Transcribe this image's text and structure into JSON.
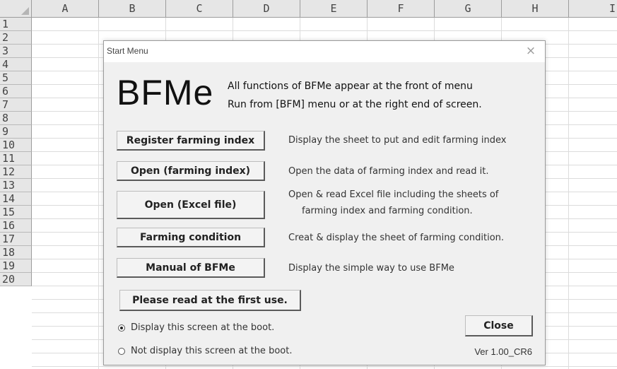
{
  "sheet": {
    "columns": [
      "A",
      "B",
      "C",
      "D",
      "E",
      "F",
      "G",
      "H",
      "I"
    ],
    "rows": [
      "1",
      "2",
      "3",
      "4",
      "5",
      "6",
      "7",
      "8",
      "9",
      "10",
      "11",
      "12",
      "13",
      "14",
      "15",
      "16",
      "17",
      "18",
      "19",
      "20"
    ]
  },
  "dialog": {
    "title": "Start Menu",
    "close_glyph": "×",
    "logo": "BFMe",
    "headline1": "All functions of BFMe appear at the front of menu",
    "headline2": "Run from [BFM] menu or at the right end of screen.",
    "buttons": [
      {
        "label": "Register farming index",
        "desc": "Display the sheet to put and edit farming index"
      },
      {
        "label": "Open (farming index)",
        "desc": "Open the data of farming index and read it."
      },
      {
        "label": "Open (Excel file)",
        "desc": "Open & read Excel file including the sheets of",
        "desc2": "farming index and farming condition."
      },
      {
        "label": "Farming condition",
        "desc": "Creat & display the sheet of farming condition."
      },
      {
        "label": "Manual of BFMe",
        "desc": "Display the simple way to use BFMe"
      }
    ],
    "first_use_label": "Please read at the first use.",
    "radio_display": "Display this screen at the boot.",
    "radio_not_display": "Not display this screen at the boot.",
    "close_label": "Close",
    "version": "Ver 1.00_CR6"
  }
}
